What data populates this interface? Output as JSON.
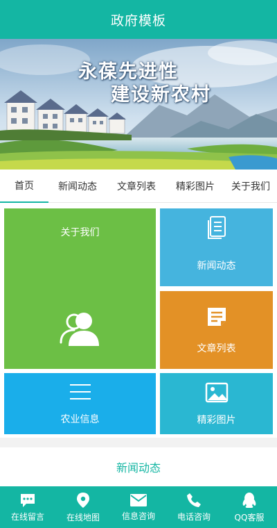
{
  "header": {
    "title": "政府模板"
  },
  "banner": {
    "line1": "永葆先进性",
    "line2": "建设新农村"
  },
  "nav": {
    "items": [
      "首页",
      "新闻动态",
      "文章列表",
      "精彩图片",
      "关于我们"
    ]
  },
  "tiles": {
    "about": "关于我们",
    "news": "新闻动态",
    "article": "文章列表",
    "agri": "农业信息",
    "pics": "精彩图片"
  },
  "section": {
    "title": "新闻动态"
  },
  "footer": {
    "items": [
      "在线留言",
      "在线地图",
      "信息咨询",
      "电话咨询",
      "QQ客服"
    ]
  },
  "colors": {
    "brand": "#14b6a3",
    "green": "#6cbf45",
    "blue": "#45b4de",
    "orange": "#e39126",
    "sky": "#1aaeea",
    "cyan": "#2ab7d2"
  }
}
